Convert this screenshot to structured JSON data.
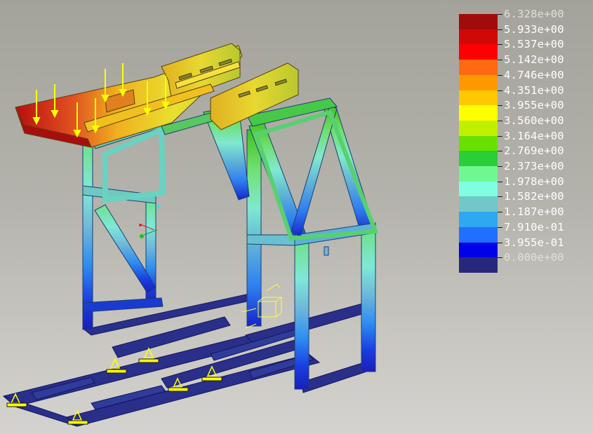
{
  "legend": {
    "labels": [
      "6.328e+00",
      "5.933e+00",
      "5.537e+00",
      "5.142e+00",
      "4.746e+00",
      "4.351e+00",
      "3.955e+00",
      "3.560e+00",
      "3.164e+00",
      "2.769e+00",
      "2.373e+00",
      "1.978e+00",
      "1.582e+00",
      "1.187e+00",
      "7.910e-01",
      "3.955e-01",
      "0.000e+00"
    ],
    "colors": [
      "#a00c0c",
      "#d10808",
      "#ff0000",
      "#ff6a10",
      "#ff9800",
      "#ffc800",
      "#ffff00",
      "#c0f000",
      "#68e000",
      "#28cf38",
      "#70f890",
      "#80ffe0",
      "#70c8c8",
      "#2ea8f0",
      "#2070ff",
      "#0000e8",
      "#28287a"
    ],
    "label_colors_note": "top and bottom labels faded"
  },
  "colors": {
    "label_text": "#ffffff",
    "label_faded": "#e0e0d8",
    "load_arrow": "#ffff00",
    "support": "#ffff00",
    "background_top": "#a4a39b",
    "background_bottom": "#d4d3cf"
  },
  "icons": [
    "load-arrow-icon",
    "support-triangle-icon",
    "axis-triad-icon",
    "bounding-box-icon"
  ]
}
